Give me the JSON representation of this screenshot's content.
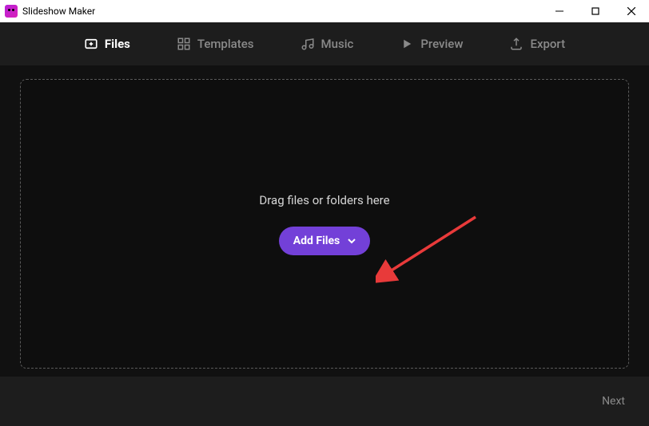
{
  "titlebar": {
    "title": "Slideshow Maker"
  },
  "nav": {
    "items": [
      {
        "label": "Files",
        "active": true
      },
      {
        "label": "Templates",
        "active": false
      },
      {
        "label": "Music",
        "active": false
      },
      {
        "label": "Preview",
        "active": false
      },
      {
        "label": "Export",
        "active": false
      }
    ]
  },
  "dropzone": {
    "text": "Drag files or folders here",
    "button_label": "Add Files"
  },
  "footer": {
    "next_label": "Next"
  },
  "colors": {
    "accent": "#7340d8",
    "annotation_arrow": "#e83a3a"
  }
}
